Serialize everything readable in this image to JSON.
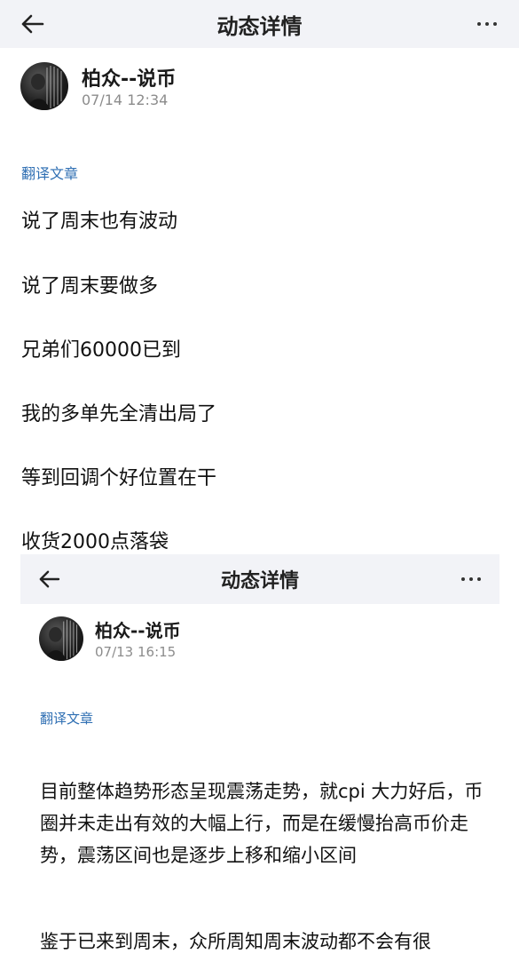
{
  "header": {
    "title": "动态详情"
  },
  "post": {
    "author": "柏众--说币",
    "time": "07/14 12:34",
    "translate": "翻译文章",
    "lines": [
      "说了周末也有波动",
      "说了周末要做多",
      "兄弟们60000已到",
      "我的多单先全清出局了",
      "等到回调个好位置在干",
      "收货2000点落袋"
    ]
  },
  "embedded": {
    "title": "动态详情",
    "author": "柏众--说币",
    "time": "07/13 16:15",
    "translate": "翻译文章",
    "paragraphs": [
      "目前整体趋势形态呈现震荡走势，就cpi 大力好后，币圈并未走出有效的大幅上行，而是在缓慢抬高币价走势，震荡区间也是逐步上移和缩小区间",
      "鉴于已来到周末，众所周知周末波动都不会有很"
    ]
  },
  "icons": {
    "back": "arrow-left-icon",
    "more": "more-dots-icon"
  },
  "colors": {
    "bar": "#f2f3f7",
    "link": "#2f6fb3",
    "time": "#8c8c8c"
  }
}
